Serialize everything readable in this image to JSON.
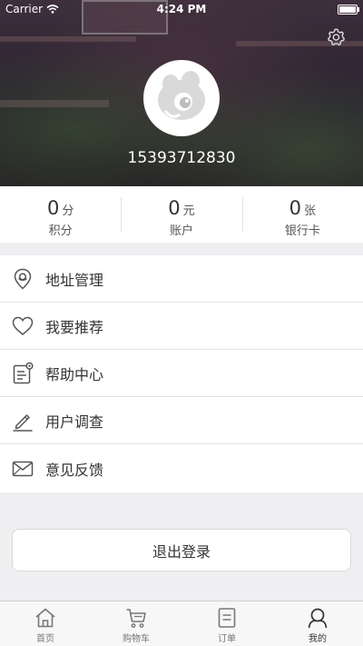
{
  "status_bar": {
    "carrier": "Carrier",
    "time": "4:24 PM"
  },
  "profile": {
    "phone": "15393712830",
    "icons": {
      "settings": "gear-icon",
      "avatar": "default-avatar-icon"
    }
  },
  "stats": [
    {
      "value": "0",
      "unit": "分",
      "label": "积分"
    },
    {
      "value": "0",
      "unit": "元",
      "label": "账户"
    },
    {
      "value": "0",
      "unit": "张",
      "label": "银行卡"
    }
  ],
  "menu": [
    {
      "label": "地址管理",
      "icon": "location-pin-icon"
    },
    {
      "label": "我要推荐",
      "icon": "heart-icon"
    },
    {
      "label": "帮助中心",
      "icon": "document-notification-icon"
    },
    {
      "label": "用户调查",
      "icon": "pencil-icon"
    },
    {
      "label": "意见反馈",
      "icon": "envelope-icon"
    }
  ],
  "logout_label": "退出登录",
  "tabbar": [
    {
      "label": "首页",
      "icon": "home-icon",
      "active": false
    },
    {
      "label": "购物车",
      "icon": "cart-icon",
      "active": false
    },
    {
      "label": "订单",
      "icon": "order-list-icon",
      "active": false
    },
    {
      "label": "我的",
      "icon": "user-profile-icon",
      "active": true
    }
  ],
  "colors": {
    "header_bg": "#2e2430",
    "page_bg": "#efeff1",
    "text": "#333333"
  }
}
